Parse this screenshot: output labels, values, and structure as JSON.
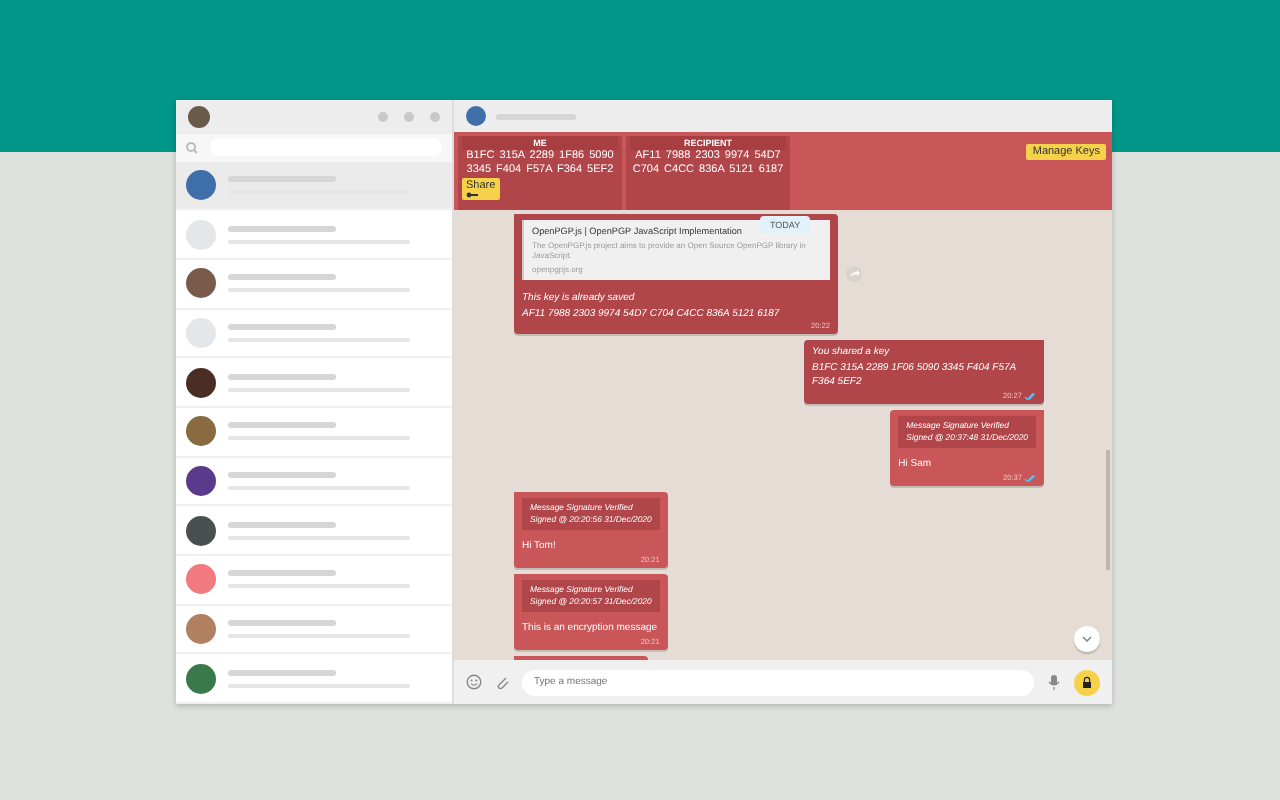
{
  "sidebar": {
    "chats": [
      {
        "color": "#3f6fa8",
        "selected": true
      },
      {
        "color": "#e3e7e9",
        "selected": false
      },
      {
        "color": "#7a5a48",
        "selected": false
      },
      {
        "color": "#e3e7e9",
        "selected": false
      },
      {
        "color": "#4a2e24",
        "selected": false
      },
      {
        "color": "#8a6a40",
        "selected": false
      },
      {
        "color": "#5a3a8a",
        "selected": false
      },
      {
        "color": "#4a5050",
        "selected": false
      },
      {
        "color": "#f07a80",
        "selected": false
      },
      {
        "color": "#b08060",
        "selected": false
      },
      {
        "color": "#3a7a4a",
        "selected": false
      }
    ]
  },
  "key_banner": {
    "columns": [
      {
        "heading": "ME",
        "lines": [
          "B1FC 315A 2289 1F86 5090",
          "3345 F404 F57A F364 5EF2"
        ]
      },
      {
        "heading": "RECIPIENT",
        "lines": [
          "AF11 7988 2303 9974 54D7",
          "C704 C4CC 836A 5121 6187"
        ]
      }
    ],
    "share_button": "Share",
    "manage_button": "Manage Keys"
  },
  "date_badge": "TODAY",
  "messages": [
    {
      "kind": "key_received",
      "outgoing": false,
      "preview": {
        "title": "OpenPGP.js | OpenPGP JavaScript Implementation",
        "description": "The OpenPGP.js project aims to provide an Open Source OpenPGP library in JavaScript.",
        "url": "openpgpjs.org"
      },
      "note": "This key is already saved",
      "fingerprint": "AF11 7988 2303 9974 54D7 C704 C4CC 836A 5121 6187",
      "time": "20:22"
    },
    {
      "kind": "key_shared",
      "outgoing": true,
      "note": "You shared a key",
      "fingerprint": "B1FC 315A 2289 1F06 5090 3345 F404 F57A F364 5EF2",
      "time": "20:27",
      "read": true
    },
    {
      "kind": "signed",
      "outgoing": true,
      "verification": "Message Signature Verified",
      "signed": "Signed @ 20:37:48 31/Dec/2020",
      "text": "Hi Sam",
      "time": "20:37",
      "read": true
    },
    {
      "kind": "signed",
      "outgoing": false,
      "verification": "Message Signature Verified",
      "signed": "Signed @ 20:20:56 31/Dec/2020",
      "text": "Hi Tom!",
      "time": "20:21"
    },
    {
      "kind": "signed",
      "outgoing": false,
      "verification": "Message Signature Verified",
      "signed": "Signed @ 20:20:57 31/Dec/2020",
      "text": "This is an encryption message",
      "time": "20:21"
    },
    {
      "kind": "partial",
      "outgoing": false
    }
  ],
  "composer": {
    "placeholder": "Type a message"
  }
}
